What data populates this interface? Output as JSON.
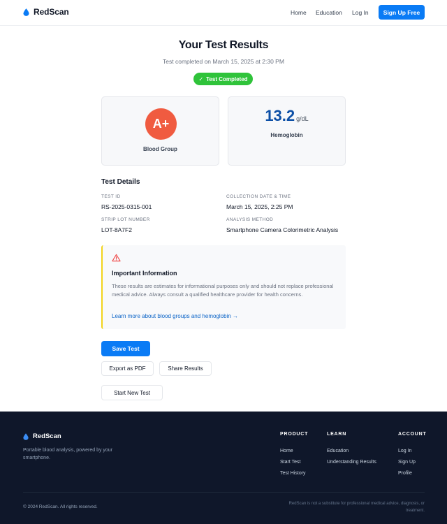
{
  "header": {
    "brand": "RedScan",
    "nav": [
      "Home",
      "Education",
      "Log In"
    ],
    "signup_label": "Sign Up Free"
  },
  "results": {
    "title": "Your Test Results",
    "completed_at": "Test completed on March 15, 2025 at 2:30 PM",
    "badge": "Test Completed",
    "badge_check": "✓"
  },
  "cards": {
    "blood_group": {
      "value": "A+",
      "label": "Blood Group"
    },
    "hemoglobin": {
      "value": "13.2",
      "unit": "g/dL",
      "label": "Hemoglobin"
    }
  },
  "details": {
    "title": "Test Details",
    "test_id": {
      "label": "TEST ID",
      "value": "RS-2025-0315-001"
    },
    "collection": {
      "label": "COLLECTION DATE & TIME",
      "value": "March 15, 2025, 2:25 PM"
    },
    "strip_lot": {
      "label": "STRIP LOT NUMBER",
      "value": "LOT-8A7F2"
    },
    "method": {
      "label": "ANALYSIS METHOD",
      "value": "Smartphone Camera Colorimetric Analysis"
    }
  },
  "info": {
    "title": "Important Information",
    "text": "These results are estimates for informational purposes only and should not replace professional medical advice. Always consult a qualified healthcare provider for health concerns.",
    "link": "Learn more about blood groups and hemoglobin →"
  },
  "actions": {
    "save": "Save Test",
    "export_pdf": "Export as PDF",
    "share": "Share Results",
    "new_test": "Start New Test"
  },
  "footer": {
    "brand": "RedScan",
    "tagline": "Portable blood analysis, powered by your smartphone.",
    "columns": [
      {
        "title": "Product",
        "links": [
          "Home",
          "Start Test",
          "Test History"
        ]
      },
      {
        "title": "Learn",
        "links": [
          "Education",
          "Understanding Results"
        ]
      },
      {
        "title": "Account",
        "links": [
          "Log In",
          "Sign Up",
          "Profile"
        ]
      }
    ],
    "copyright": "© 2024 RedScan. All rights reserved.",
    "disclaimer": "RedScan is not a substitute for professional medical advice, diagnosis, or treatment."
  },
  "colors": {
    "primary": "#0a7bf5",
    "success": "#2fc33a",
    "blood": "#f05b40",
    "hemoglobin": "#0c4fa6",
    "warning_border": "#f2d31b",
    "footer_bg": "#0f172a"
  },
  "icons": {
    "logo": "blood-drop-icon",
    "warning": "warning-triangle-icon",
    "check": "check-icon"
  }
}
